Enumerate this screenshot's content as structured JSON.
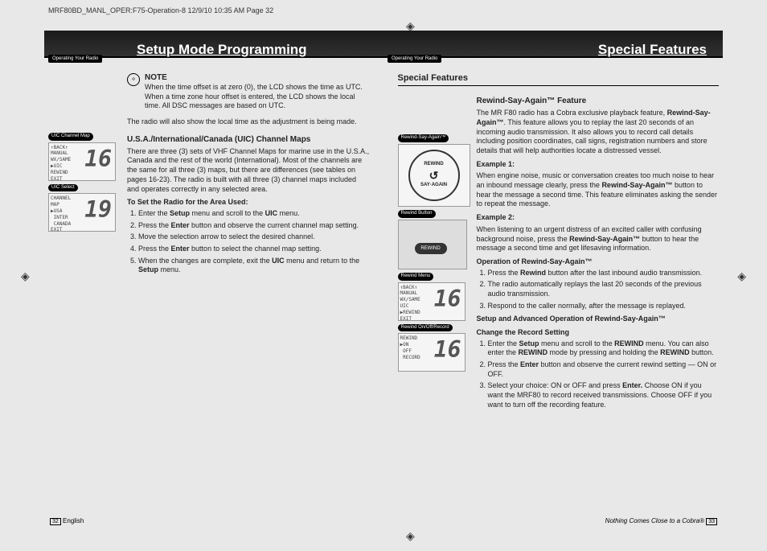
{
  "header_line": "MRF80BD_MANL_OPER:F75-Operation-8  12/9/10  10:35 AM  Page 32",
  "banner": {
    "left_tab": "Operating Your Radio",
    "left_title": "Setup Mode Programming",
    "right_tab": "Operating Your Radio",
    "right_title": "Special Features"
  },
  "left_page": {
    "note_title": "NOTE",
    "note_body": "When the time offset is at zero (0), the LCD shows the time as UTC. When a time zone hour offset is entered, the LCD shows the local time. All DSC messages are based on UTC.",
    "note_extra": "The radio will also show the local time as the adjustment is being made.",
    "lcd1_label": "UIC Channel Map",
    "lcd1_lines": "↑BACK↑\nMANUAL\nWX/SAME\n▶UIC\nREWIND\nEXIT",
    "lcd1_num": "16",
    "lcd2_label": "UIC Select",
    "lcd2_lines": "CHANNEL\nMAP\n▶USA\n INTER\n CANADA\nEXIT",
    "lcd2_num": "19",
    "uic_heading": "U.S.A./International/Canada (UIC) Channel Maps",
    "uic_body": "There are three (3) sets of VHF Channel Maps for marine use in the U.S.A., Canada and the rest of the world (International). Most of the channels are the same for all three (3) maps, but there are differences (see tables on pages 16-23). The radio is built with all three (3) channel maps included and operates correctly in any selected area.",
    "uic_set_heading": "To Set the Radio for the Area Used:",
    "uic_steps": [
      "Enter the <b>Setup</b> menu and scroll to the <b>UIC</b> menu.",
      "Press the <b>Enter</b> button and observe the current channel map setting.",
      "Move the selection arrow to select the desired channel.",
      "Press the <b>Enter</b> button to select the channel map setting.",
      "When the changes are complete, exit the <b>UIC</b> menu and return to the <b>Setup</b> menu."
    ]
  },
  "right_page": {
    "section_title": "Special Features",
    "rsa_heading": "Rewind-Say-Again™ Feature",
    "rsa_intro": "The MR F80 radio has a Cobra exclusive playback feature, <b>Rewind-Say-Again™</b>. This feature allows you to replay the last 20 seconds of an incoming audio transmission. It also allows you to record call details including position coordinates, call signs, registration numbers and store details that will help authorities locate a distressed vessel.",
    "ex1_title": "Example 1:",
    "ex1_body": "When engine noise, music or conversation creates too much noise to hear an inbound message clearly, press the <b>Rewind-Say-Again™</b> button to hear the message a second time. This feature eliminates asking the sender to repeat the message.",
    "ex2_title": "Example 2:",
    "ex2_body": "When listening to an urgent distress of an excited caller with confusing background noise, press the <b>Rewind-Say-Again™</b> button to hear the message a second time and get lifesaving information.",
    "op_title": "Operation of Rewind-Say-Again™",
    "op_steps": [
      "Press the <b>Rewind</b> button after the last inbound audio transmission.",
      "The radio automatically replays the last 20 seconds of the previous audio transmission.",
      "Respond to the caller normally, after the message is replayed."
    ],
    "adv_title": "Setup and Advanced Operation of Rewind-Say-Again™",
    "change_title": "Change the Record Setting",
    "change_steps": [
      "Enter the <b>Setup</b> menu and scroll to the <b>REWIND</b> menu. You can also enter the <b>REWIND</b> mode by pressing and holding the <b>REWIND</b> button.",
      "Press the <b>Enter</b> button and observe the current rewind setting — ON or OFF.",
      "Select your choice: ON or OFF and press <b>Enter.</b> Choose ON if you want the MRF80 to record received transmissions. Choose OFF if you want to turn off the recording feature."
    ],
    "label_rsa": "Rewind-Say-Again™",
    "label_rbtn": "Rewind Button",
    "label_rmenu": "Rewind Menu",
    "lcd3_lines": "↑BACK↑\nMANUAL\nWX/SAME\nUIC\n▶REWIND\nEXIT",
    "lcd3_num": "16",
    "label_roor": "Rewind On/Off/Record",
    "lcd4_lines": "REWIND\n▶ON\n OFF\n RECORD",
    "lcd4_num": "16",
    "badge_top": "REWIND",
    "badge_mid": "↺",
    "badge_bot": "SAY·AGAIN",
    "rewind_btn": "REWIND"
  },
  "footer": {
    "left_num": "32",
    "left_text": "English",
    "right_text": "Nothing Comes Close to a Cobra®",
    "right_num": "33"
  }
}
